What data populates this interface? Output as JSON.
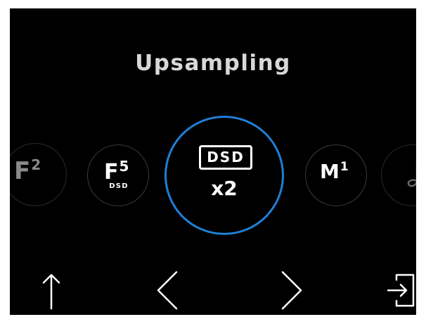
{
  "screen": {
    "title": "Upsampling"
  },
  "modes": [
    {
      "id": "f2",
      "label": "F",
      "superscript": "2",
      "selected": false
    },
    {
      "id": "f5",
      "label": "F",
      "superscript": "5",
      "sublabel": "DSD",
      "selected": false
    },
    {
      "id": "dsd",
      "label": "DSD",
      "multiplier": "x2",
      "selected": true
    },
    {
      "id": "m1",
      "label": "M",
      "superscript": "1",
      "selected": false
    },
    {
      "id": "music",
      "icon": "music-note-icon",
      "selected": false
    }
  ],
  "controls": {
    "up_icon": "up-arrow-icon",
    "prev_icon": "chevron-left-icon",
    "next_icon": "chevron-right-icon",
    "enter_icon": "enter-icon"
  },
  "colors": {
    "background": "#000000",
    "selected_ring": "#1f7fd6",
    "title": "#d8d8d8",
    "text": "#ffffff"
  }
}
